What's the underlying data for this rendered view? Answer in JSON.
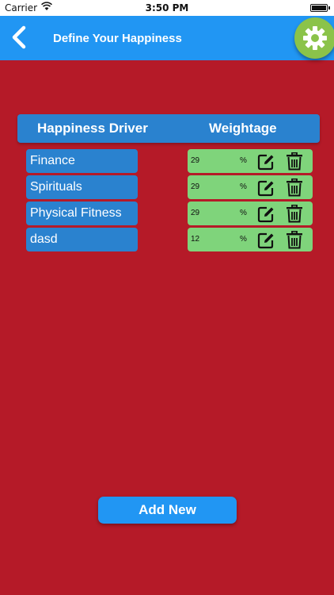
{
  "status_bar": {
    "carrier": "Carrier",
    "time": "3:50 PM"
  },
  "nav": {
    "title": "Define Your Happiness"
  },
  "table": {
    "header_driver": "Happiness Driver",
    "header_weightage": "Weightage",
    "rows": [
      {
        "driver": "Finance",
        "weight": "29",
        "unit": "%"
      },
      {
        "driver": "Spirituals",
        "weight": "29",
        "unit": "%"
      },
      {
        "driver": "Physical Fitness",
        "weight": "29",
        "unit": "%"
      },
      {
        "driver": "dasd",
        "weight": "12",
        "unit": "%"
      }
    ]
  },
  "add_button": {
    "label": "Add New"
  },
  "colors": {
    "background": "#b51a28",
    "nav_bar": "#2196f3",
    "cell_blue": "#2a82cf",
    "cell_green": "#7fd47b",
    "settings": "#8bc34a"
  },
  "icons": {
    "back": "chevron-left-icon",
    "settings": "gear-icon",
    "edit": "edit-icon",
    "delete": "trash-icon"
  }
}
